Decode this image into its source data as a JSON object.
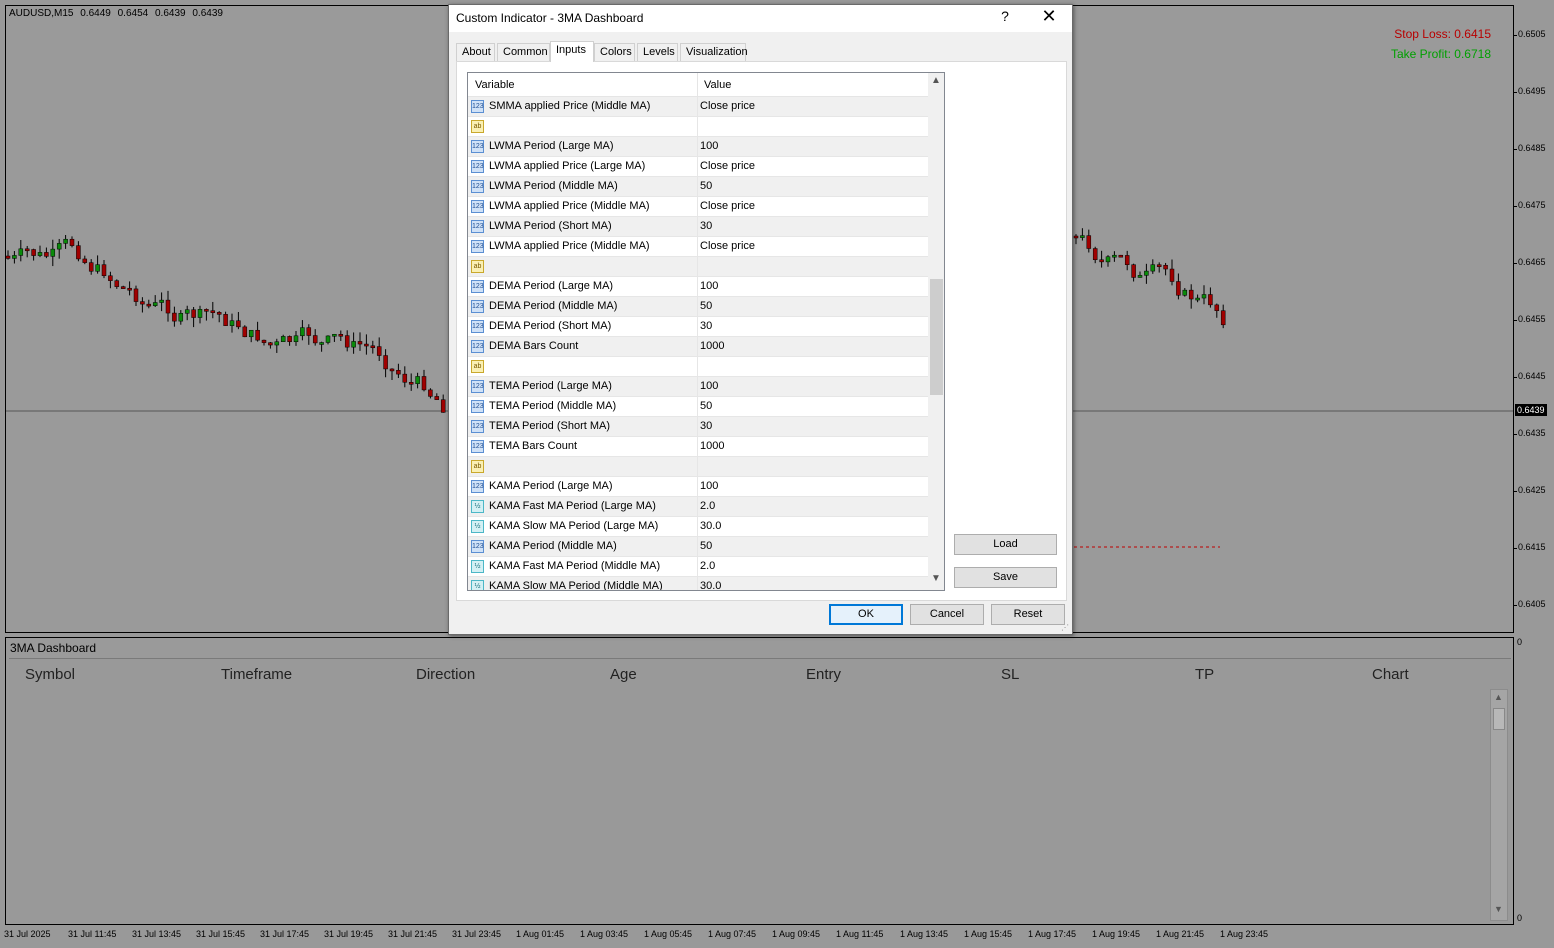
{
  "chart": {
    "header": {
      "symbol": "AUDUSD,M15",
      "open": "0.6449",
      "high": "0.6454",
      "low": "0.6439",
      "close": "0.6439"
    },
    "stop_loss": "Stop Loss: 0.6415",
    "take_profit": "Take Profit: 0.6718",
    "current_price": "0.6439",
    "price_scale": [
      "0.6505",
      "0.6495",
      "0.6485",
      "0.6475",
      "0.6465",
      "0.6455",
      "0.6445",
      "0.6435",
      "0.6425",
      "0.6415",
      "0.6405"
    ],
    "time_axis": [
      "31 Jul 2025",
      "31 Jul 11:45",
      "31 Jul 13:45",
      "31 Jul 15:45",
      "31 Jul 17:45",
      "31 Jul 19:45",
      "31 Jul 21:45",
      "31 Jul 23:45",
      "1 Aug 01:45",
      "1 Aug 03:45",
      "1 Aug 05:45",
      "1 Aug 07:45",
      "1 Aug 09:45",
      "1 Aug 11:45",
      "1 Aug 13:45",
      "1 Aug 15:45",
      "1 Aug 17:45",
      "1 Aug 19:45",
      "1 Aug 21:45",
      "1 Aug 23:45"
    ],
    "colors": {
      "bull": "#0a8a0a",
      "bear": "#a00000",
      "wick": "#000000",
      "stop_line": "#c00000"
    }
  },
  "dashboard": {
    "title": "3MA Dashboard",
    "columns": [
      "Symbol",
      "Timeframe",
      "Direction",
      "Age",
      "Entry",
      "SL",
      "TP",
      "Chart"
    ],
    "scale_top": "0",
    "scale_bottom": "0"
  },
  "dialog": {
    "title": "Custom Indicator - 3MA Dashboard",
    "help_icon": "?",
    "close_icon": "✕",
    "tabs": [
      "About",
      "Common",
      "Inputs",
      "Colors",
      "Levels",
      "Visualization"
    ],
    "active_tab": "Inputs",
    "grid_headers": {
      "variable": "Variable",
      "value": "Value"
    },
    "rows": [
      {
        "type": "int",
        "icon": "123",
        "variable": "SMMA applied Price (Middle MA)",
        "value": "Close price"
      },
      {
        "type": "str",
        "icon": "ab",
        "variable": "",
        "value": ""
      },
      {
        "type": "int",
        "icon": "123",
        "variable": "LWMA Period (Large MA)",
        "value": "100"
      },
      {
        "type": "int",
        "icon": "123",
        "variable": "LWMA applied Price (Large MA)",
        "value": "Close price"
      },
      {
        "type": "int",
        "icon": "123",
        "variable": "LWMA Period (Middle MA)",
        "value": "50"
      },
      {
        "type": "int",
        "icon": "123",
        "variable": "LWMA applied Price (Middle MA)",
        "value": "Close price"
      },
      {
        "type": "int",
        "icon": "123",
        "variable": "LWMA Period (Short MA)",
        "value": "30"
      },
      {
        "type": "int",
        "icon": "123",
        "variable": "LWMA applied Price (Middle MA)",
        "value": "Close price"
      },
      {
        "type": "str",
        "icon": "ab",
        "variable": "",
        "value": ""
      },
      {
        "type": "int",
        "icon": "123",
        "variable": "DEMA Period (Large MA)",
        "value": "100"
      },
      {
        "type": "int",
        "icon": "123",
        "variable": "DEMA Period (Middle MA)",
        "value": "50"
      },
      {
        "type": "int",
        "icon": "123",
        "variable": "DEMA Period (Short MA)",
        "value": "30"
      },
      {
        "type": "int",
        "icon": "123",
        "variable": "DEMA Bars Count",
        "value": "1000"
      },
      {
        "type": "str",
        "icon": "ab",
        "variable": "",
        "value": ""
      },
      {
        "type": "int",
        "icon": "123",
        "variable": "TEMA Period (Large MA)",
        "value": "100"
      },
      {
        "type": "int",
        "icon": "123",
        "variable": "TEMA Period (Middle MA)",
        "value": "50"
      },
      {
        "type": "int",
        "icon": "123",
        "variable": "TEMA Period (Short MA)",
        "value": "30"
      },
      {
        "type": "int",
        "icon": "123",
        "variable": "TEMA Bars Count",
        "value": "1000"
      },
      {
        "type": "str",
        "icon": "ab",
        "variable": "",
        "value": ""
      },
      {
        "type": "int",
        "icon": "123",
        "variable": "KAMA Period (Large MA)",
        "value": "100"
      },
      {
        "type": "dbl",
        "icon": "½",
        "variable": "KAMA Fast MA Period (Large MA)",
        "value": "2.0"
      },
      {
        "type": "dbl",
        "icon": "½",
        "variable": "KAMA Slow MA Period (Large MA)",
        "value": "30.0"
      },
      {
        "type": "int",
        "icon": "123",
        "variable": "KAMA Period (Middle MA)",
        "value": "50"
      },
      {
        "type": "dbl",
        "icon": "½",
        "variable": "KAMA Fast MA Period (Middle MA)",
        "value": "2.0"
      },
      {
        "type": "dbl",
        "icon": "½",
        "variable": "KAMA Slow MA Period (Middle MA)",
        "value": "30.0"
      }
    ],
    "buttons": {
      "load": "Load",
      "save": "Save",
      "ok": "OK",
      "cancel": "Cancel",
      "reset": "Reset"
    },
    "scroll": {
      "up": "▲",
      "down": "▼"
    },
    "grip": "⋰"
  }
}
